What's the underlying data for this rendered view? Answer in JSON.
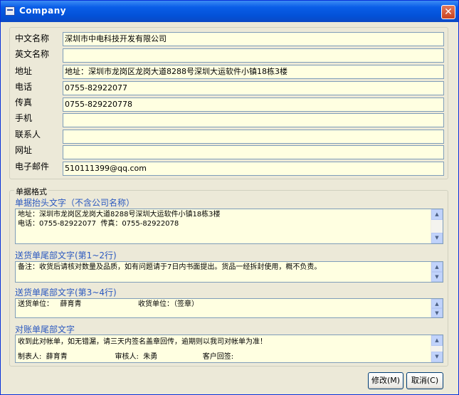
{
  "window": {
    "title": "Company",
    "close_glyph": "✕"
  },
  "fields": [
    {
      "label": "中文名称",
      "value": "深圳市中电科技开发有限公司"
    },
    {
      "label": "英文名称",
      "value": ""
    },
    {
      "label": "地址",
      "value": "地址：深圳市龙岗区龙岗大道8288号深圳大运软件小镇18栋3楼"
    },
    {
      "label": "电话",
      "value": "0755-82922077"
    },
    {
      "label": "传真",
      "value": "0755-829220778"
    },
    {
      "label": "手机",
      "value": ""
    },
    {
      "label": "联系人",
      "value": ""
    },
    {
      "label": "网址",
      "value": ""
    },
    {
      "label": "电子邮件",
      "value": "510111399@qq.com"
    }
  ],
  "format_group": {
    "caption": "单据格式",
    "header": {
      "label": "单据抬头文字（不含公司名称）",
      "line1": "地址：深圳市龙岗区龙岗大道8288号深圳大运软件小镇18栋3楼",
      "line2": "电话：0755-82922077  传真：0755-82922078"
    },
    "delivery_footer_1_2": {
      "label": "送货单尾部文字(第1~2行)",
      "line1": "备注：收货后请核对数量及品质，如有问题请于7日内书面提出。货品一经拆封使用，概不负责。"
    },
    "delivery_footer_3_4": {
      "label": "送货单尾部文字(第3~4行)",
      "line1": "送货单位：   薛育青                         收货单位：（签章）"
    },
    "statement_footer": {
      "label": "对账单尾部文字",
      "line1": "收到此对帐单，如无错漏，请三天内签名盖章回传，逾期则以我司对帐单为准！",
      "line2": "制表人:  薛育青                     审核人:  朱勇                    客户回签:"
    }
  },
  "buttons": {
    "modify": "修改(M)",
    "cancel": "取消(C)"
  }
}
